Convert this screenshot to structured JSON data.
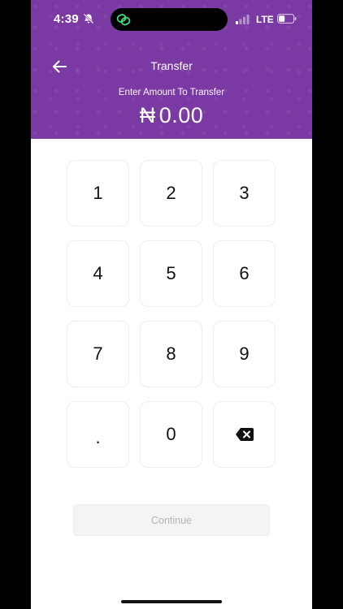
{
  "status_bar": {
    "time": "4:39",
    "network": "LTE"
  },
  "header": {
    "title": "Transfer",
    "subtitle": "Enter Amount To Transfer",
    "currency_symbol": "₦",
    "amount": "0.00"
  },
  "keypad": {
    "keys": [
      "1",
      "2",
      "3",
      "4",
      "5",
      "6",
      "7",
      "8",
      "9",
      ".",
      "0"
    ]
  },
  "continue_label": "Continue",
  "colors": {
    "header_bg": "#7b3aa3",
    "key_border": "#eeeeee",
    "continue_bg": "#f4f4f4",
    "continue_text": "#b4b4b4",
    "island_icon": "#3cdc78"
  },
  "icons": [
    "bell-mute-icon",
    "link-icon",
    "signal-icon",
    "battery-icon",
    "back-arrow-icon",
    "backspace-icon"
  ]
}
